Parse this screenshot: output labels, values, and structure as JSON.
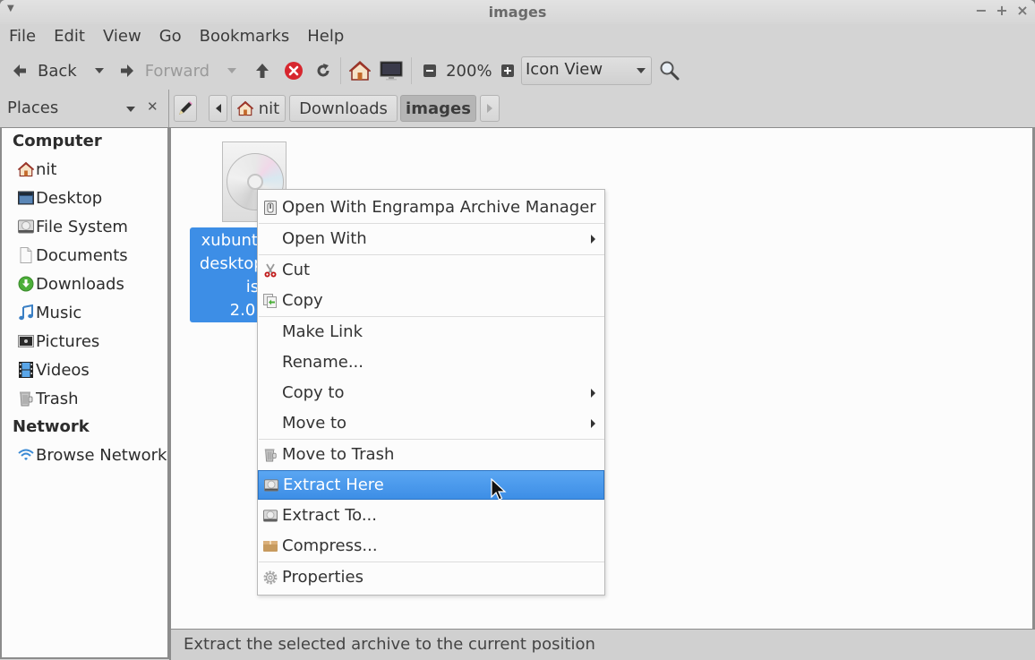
{
  "window": {
    "title": "images",
    "controls": [
      "minimize",
      "maximize",
      "close"
    ],
    "control_glyphs": {
      "minimize": "−",
      "maximize": "+",
      "close": "×"
    }
  },
  "menubar": {
    "items": [
      "File",
      "Edit",
      "View",
      "Go",
      "Bookmarks",
      "Help"
    ]
  },
  "toolbar": {
    "back_label": "Back",
    "forward_label": "Forward",
    "zoom_level": "200%",
    "view_mode": "Icon View",
    "icons": {
      "back": "arrow-left-icon",
      "back_history": "chevron-down-icon",
      "forward": "arrow-right-icon",
      "forward_history": "chevron-down-icon",
      "up": "arrow-up-icon",
      "stop": "stop-icon",
      "reload": "reload-icon",
      "home": "home-icon",
      "computer": "computer-icon",
      "zoom_out": "zoom-out-icon",
      "zoom_in": "zoom-in-icon",
      "search": "search-icon"
    }
  },
  "places": {
    "header_label": "Places",
    "sections": [
      {
        "title": "Computer",
        "items": [
          {
            "label": "nit",
            "icon": "home-icon"
          },
          {
            "label": "Desktop",
            "icon": "desktop-icon"
          },
          {
            "label": "File System",
            "icon": "drive-icon"
          },
          {
            "label": "Documents",
            "icon": "document-icon"
          },
          {
            "label": "Downloads",
            "icon": "download-icon"
          },
          {
            "label": "Music",
            "icon": "music-icon"
          },
          {
            "label": "Pictures",
            "icon": "pictures-icon"
          },
          {
            "label": "Videos",
            "icon": "videos-icon"
          },
          {
            "label": "Trash",
            "icon": "trash-icon"
          }
        ]
      },
      {
        "title": "Network",
        "items": [
          {
            "label": "Browse Network",
            "icon": "network-icon"
          }
        ]
      }
    ]
  },
  "pathbar": {
    "segments": [
      {
        "label": "nit",
        "icon": "home-icon",
        "active": false
      },
      {
        "label": "Downloads",
        "active": false
      },
      {
        "label": "images",
        "active": true
      }
    ]
  },
  "file": {
    "name_lines": [
      "xubuntu",
      "desktop-",
      "is",
      "2.0"
    ],
    "icon": "disc-image-icon",
    "selected": true
  },
  "context_menu": {
    "items": [
      {
        "label": "Open With Engrampa Archive Manager",
        "icon": "archive-manager-icon",
        "submenu": false
      },
      {
        "label": "Open With",
        "icon": null,
        "submenu": true
      },
      {
        "label": "Cut",
        "icon": "cut-icon",
        "submenu": false
      },
      {
        "label": "Copy",
        "icon": "copy-icon",
        "submenu": false
      },
      {
        "label": "Make Link",
        "icon": null,
        "submenu": false
      },
      {
        "label": "Rename...",
        "icon": null,
        "submenu": false
      },
      {
        "label": "Copy to",
        "icon": null,
        "submenu": true
      },
      {
        "label": "Move to",
        "icon": null,
        "submenu": true
      },
      {
        "label": "Move to Trash",
        "icon": "trash-icon",
        "submenu": false
      },
      {
        "label": "Extract Here",
        "icon": "extract-icon",
        "submenu": false,
        "highlighted": true
      },
      {
        "label": "Extract To...",
        "icon": "extract-icon",
        "submenu": false
      },
      {
        "label": "Compress...",
        "icon": "package-icon",
        "submenu": false
      },
      {
        "label": "Properties",
        "icon": "gear-icon",
        "submenu": false
      }
    ]
  },
  "statusbar": {
    "text": "Extract the selected archive to the current position"
  },
  "colors": {
    "selection": "#3d8ee6",
    "window_bg": "#d4d4d4",
    "content_bg": "#fcfcfc"
  }
}
